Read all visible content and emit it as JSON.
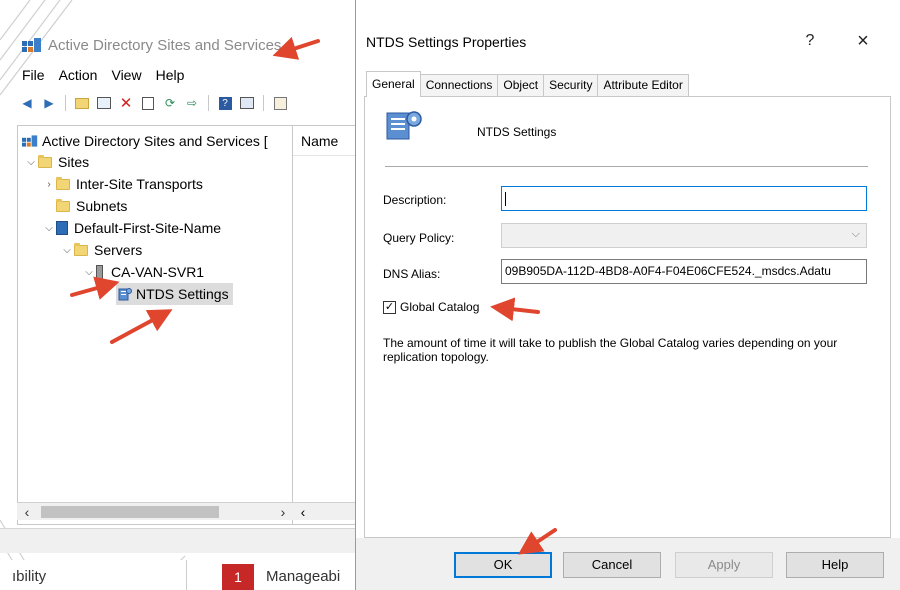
{
  "mmc": {
    "title": "Active Directory Sites and Services",
    "menu": [
      "File",
      "Action",
      "View",
      "Help"
    ],
    "list_header": "Name",
    "tree": {
      "root": "Active Directory Sites and Services [",
      "sites": "Sites",
      "inter_site": "Inter-Site Transports",
      "subnets": "Subnets",
      "default_site": "Default-First-Site-Name",
      "servers": "Servers",
      "server": "CA-VAN-SVR1",
      "ntds": "NTDS Settings"
    }
  },
  "taskbar": {
    "left_text": "ıbility",
    "badge": "1",
    "right_text": "Manageabi"
  },
  "dialog": {
    "title": "NTDS Settings Properties",
    "help": "?",
    "close": "×",
    "tabs": [
      "General",
      "Connections",
      "Object",
      "Security",
      "Attribute Editor"
    ],
    "object_name": "NTDS Settings",
    "description_label": "Description:",
    "description_value": "",
    "query_policy_label": "Query Policy:",
    "query_policy_value": "",
    "dns_alias_label": "DNS Alias:",
    "dns_alias_value": "09B905DA-112D-4BD8-A0F4-F04E06CFE524._msdcs.Adatu",
    "global_catalog_label": "Global Catalog",
    "global_catalog_checked": true,
    "note": "The amount of time it will take to publish the Global Catalog varies depending on your replication topology.",
    "buttons": {
      "ok": "OK",
      "cancel": "Cancel",
      "apply": "Apply",
      "help": "Help"
    }
  },
  "colors": {
    "accent": "#0078d7",
    "annotation_arrow": "#e0452e",
    "badge": "#c62828"
  },
  "icons": [
    "app-icon",
    "folder-icon",
    "site-icon",
    "server-icon",
    "ntds-settings-icon",
    "back-icon",
    "forward-icon",
    "delete-icon",
    "refresh-icon",
    "help-icon",
    "dropdown-arrow-icon",
    "close-icon"
  ]
}
